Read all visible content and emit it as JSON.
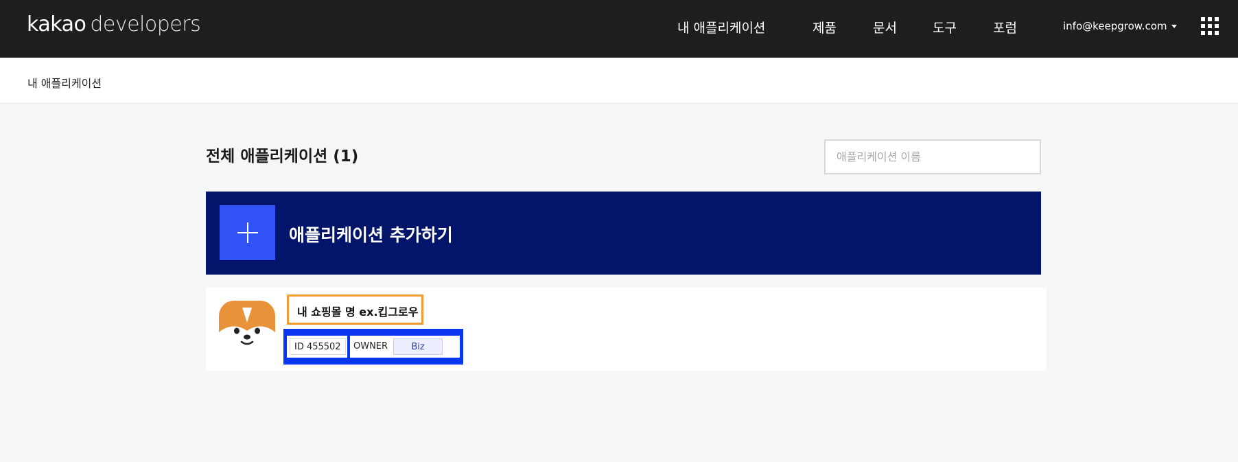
{
  "header": {
    "logo_brand": "kakao",
    "logo_suffix": "developers",
    "nav": [
      {
        "label": "내 애플리케이션"
      },
      {
        "label": "제품"
      },
      {
        "label": "문서"
      },
      {
        "label": "도구"
      },
      {
        "label": "포럼"
      }
    ],
    "account_email": "info@keepgrow.com",
    "apps_menu_icon": "grid-icon"
  },
  "breadcrumb": {
    "title": "내 애플리케이션"
  },
  "main": {
    "title": "전체 애플리케이션 (1)",
    "search_placeholder": "애플리케이션 이름",
    "add_app_label": "애플리케이션 추가하기",
    "apps": [
      {
        "name": "내 쇼핑몰 명 ex.킵그로우",
        "id_label": "ID 455502",
        "role": "OWNER",
        "type": "Biz"
      }
    ]
  },
  "colors": {
    "header_bg": "#1e1e1e",
    "add_app_bg": "#02156b",
    "plus_box_bg": "#3152f5",
    "name_highlight": "#f19a36",
    "badge_highlight": "#0b36f0"
  }
}
